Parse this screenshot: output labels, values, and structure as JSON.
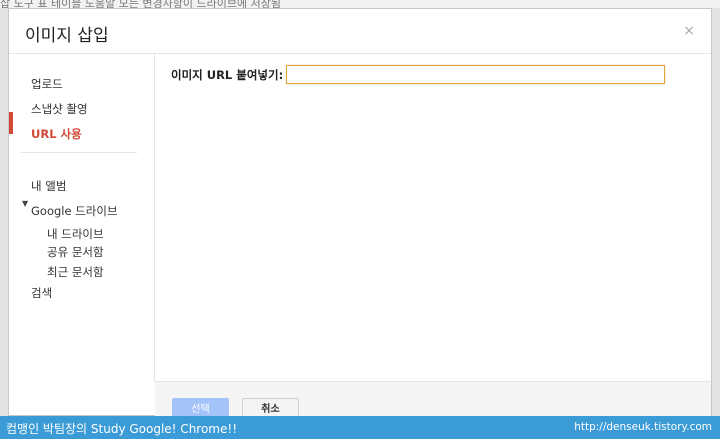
{
  "background": {
    "menubar_text": "삽   도구   표 테이블   도움말   모든 변경사항이 드라이브에 저장됨"
  },
  "dialog": {
    "title": "이미지 삽입",
    "close_icon": "×"
  },
  "sidebar": {
    "items": [
      {
        "label": "업로드"
      },
      {
        "label": "스냅샷 촬영"
      },
      {
        "label": "URL 사용",
        "active": true
      },
      {
        "label": "내 앨범"
      },
      {
        "label": "Google 드라이브"
      },
      {
        "label": "내 드라이브"
      },
      {
        "label": "공유 문서함"
      },
      {
        "label": "최근 문서함"
      },
      {
        "label": "검색"
      }
    ],
    "expand_icon": "▼"
  },
  "content": {
    "url_label": "이미지 URL 붙여넣기:",
    "url_value": ""
  },
  "footer": {
    "select_label": "선택",
    "cancel_label": "취소"
  },
  "banner": {
    "left_text": "컴맹인 박팀장의 Study Google! Chrome!!",
    "right_text": "http://denseuk.tistory.com"
  },
  "colors": {
    "accent": "#d14836",
    "input_focus": "#e3a43f",
    "select_button": "#a4c3f8",
    "banner": "#3b9bd6"
  }
}
